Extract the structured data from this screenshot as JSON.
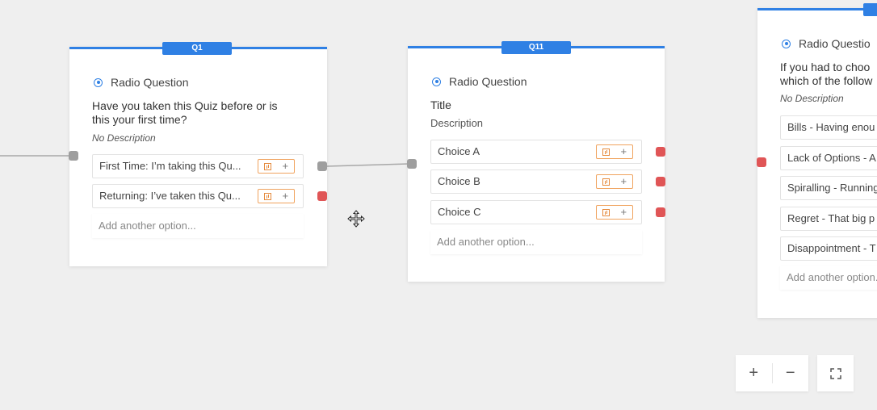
{
  "nodes": [
    {
      "tag": "Q1",
      "type_label": "Radio Question",
      "title": "Have you taken this Quiz before or is this your first time?",
      "description": "No Description",
      "options": [
        "First Time: I’m taking this Qu...",
        "Returning: I’ve taken this Qu..."
      ],
      "add_option": "Add another option..."
    },
    {
      "tag": "Q11",
      "type_label": "Radio Question",
      "title": "Title",
      "description": "Description",
      "options": [
        "Choice A",
        "Choice B",
        "Choice C"
      ],
      "add_option": "Add another option..."
    },
    {
      "tag": "",
      "type_label": "Radio Questio",
      "title": "If you had to choo which of the follow",
      "description": "No Description",
      "options": [
        "Bills - Having enou",
        "Lack of Options - A",
        "Spiralling - Running",
        "Regret - That big p",
        "Disappointment - T"
      ],
      "add_option": "Add another option."
    }
  ],
  "controls": {
    "zoom_in": "+",
    "zoom_out": "−"
  },
  "colors": {
    "accent": "#2f80e4",
    "port_grey": "#9e9e9e",
    "port_red": "#e05556",
    "action_orange": "#f0a35e"
  },
  "icons": [
    "radio-icon",
    "chart-icon",
    "plus-icon",
    "fullscreen-icon",
    "move-cursor-icon"
  ]
}
